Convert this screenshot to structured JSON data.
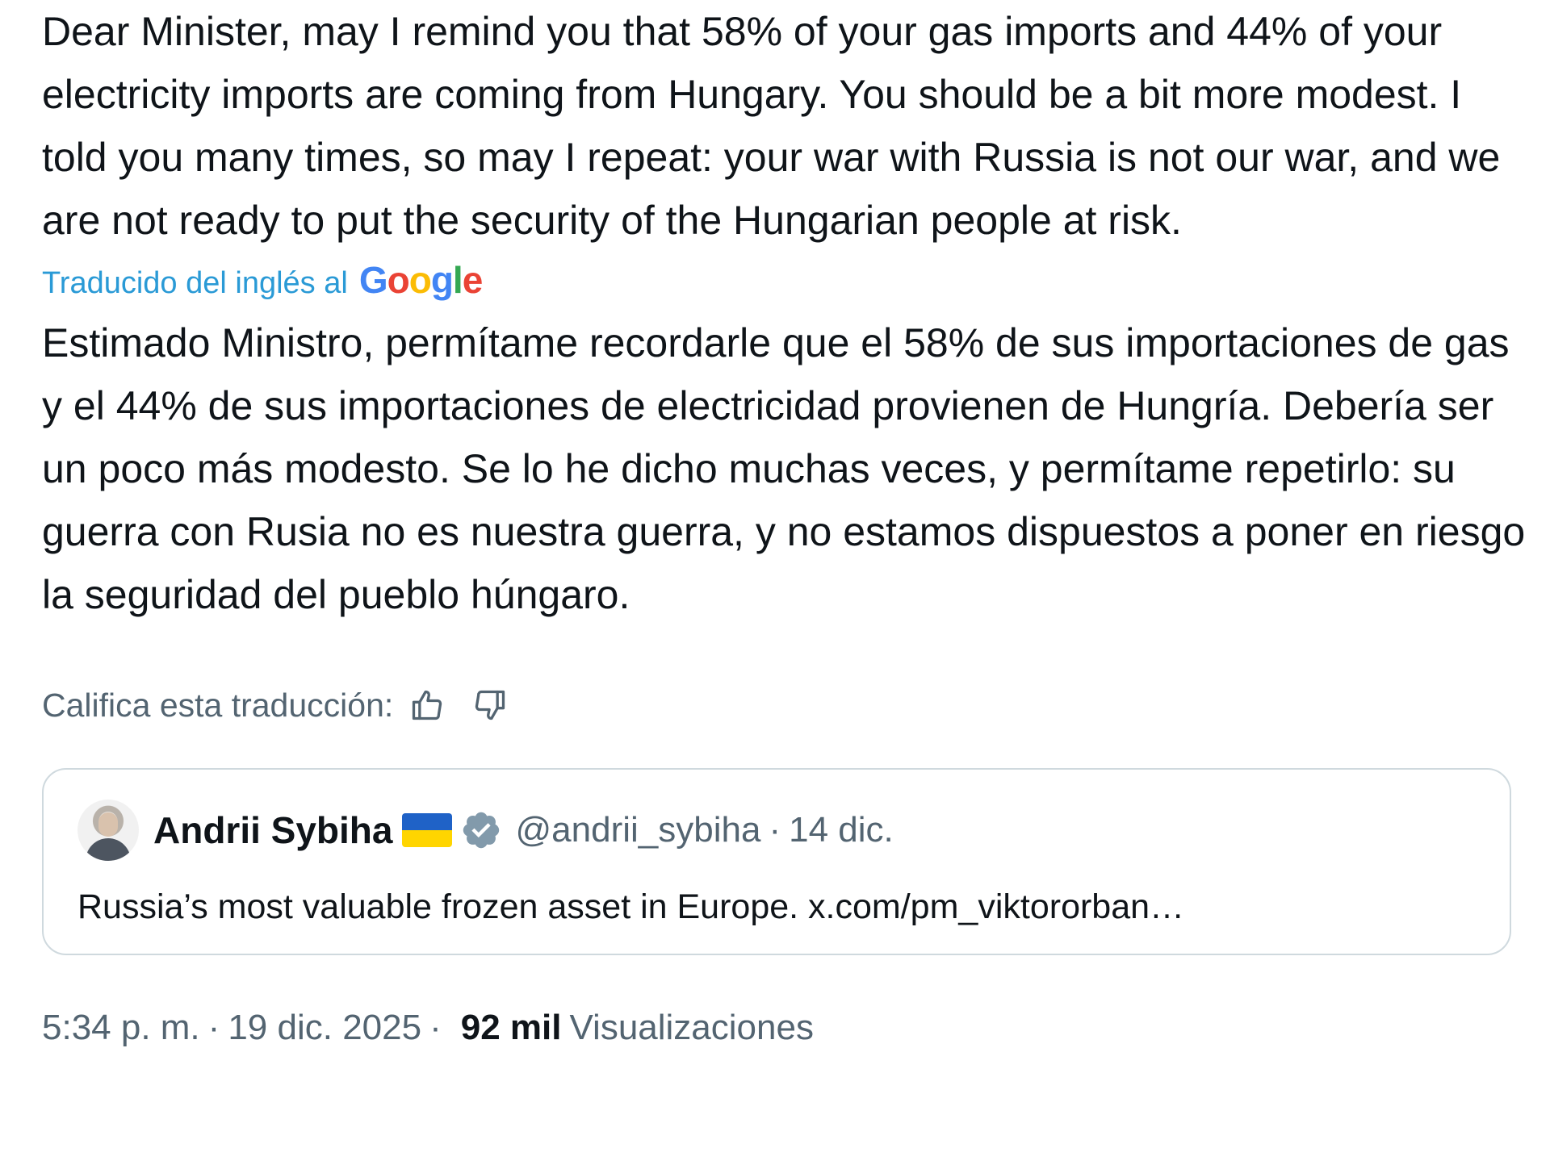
{
  "tweet": {
    "original_text": "Dear Minister, may I remind you that 58% of your gas imports and 44% of your electricity imports are coming from Hungary. You should be a bit more modest. I told you many times, so may I repeat: your war with Russia is not our war, and we are not ready to put the security of the Hungarian people at risk.",
    "translated_by_label": "Traducido del inglés al",
    "translator_logo_text": "Google",
    "translated_text": "Estimado Ministro, permítame recordarle que el 58% de sus importaciones de gas y el 44% de sus importaciones de electricidad provienen de Hungría. Debería ser un poco más modesto. Se lo he dicho muchas veces, y permítame repetirlo: su guerra con Rusia no es nuestra guerra, y no estamos dispuestos a poner en riesgo la seguridad del pueblo húngaro.",
    "rate_label": "Califica esta traducción:",
    "rate_up_icon": "thumbs-up-icon",
    "rate_down_icon": "thumbs-down-icon"
  },
  "quoted_tweet": {
    "author_name": "Andrii Sybiha",
    "flag_icon": "ukraine-flag-icon",
    "verified_icon": "verified-badge-icon",
    "handle": "@andrii_sybiha",
    "separator": "·",
    "date": "14 dic.",
    "text": "Russia’s most valuable frozen asset in Europe. x.com/pm_viktororban…"
  },
  "footer": {
    "time": "5:34 p. m.",
    "separator": "·",
    "date": "19 dic. 2025",
    "separator2": "·",
    "views_count": "92 mil",
    "views_label": "Visualizaciones"
  },
  "colors": {
    "text_primary": "#0f1419",
    "text_secondary": "#536471",
    "translation_link": "#2a9ad6",
    "border": "#cfd9de",
    "google_blue": "#4285F4",
    "google_red": "#EA4335",
    "google_yellow": "#FBBC05",
    "google_green": "#34A853",
    "verified_badge": "#829aab"
  }
}
